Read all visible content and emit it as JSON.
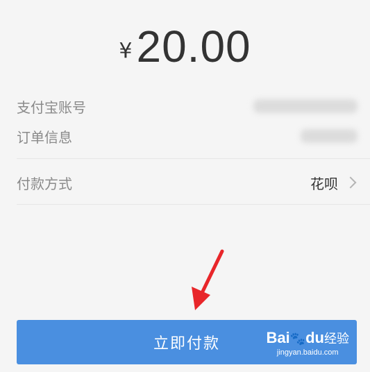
{
  "payment": {
    "currency_symbol": "¥",
    "amount": "20.00"
  },
  "details": {
    "account_label": "支付宝账号",
    "order_label": "订单信息"
  },
  "method": {
    "label": "付款方式",
    "value": "花呗"
  },
  "pay_button": {
    "label": "立即付款",
    "color": "#4a8fe0"
  },
  "annotation": {
    "arrow_color": "#e8262a"
  },
  "watermark": {
    "brand": "Bai",
    "brand_suffix": "du",
    "product": "经验",
    "site": "jingyan.baidu.com"
  }
}
